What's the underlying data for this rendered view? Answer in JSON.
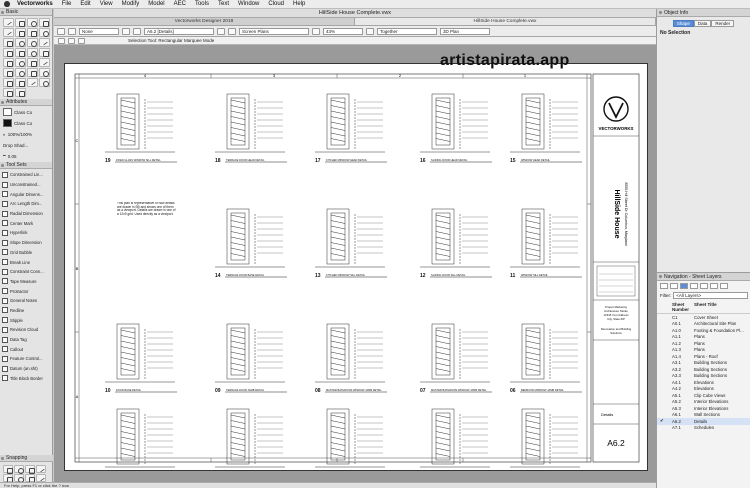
{
  "menubar": {
    "app": "Vectorworks",
    "items": [
      "File",
      "Edit",
      "View",
      "Modify",
      "Model",
      "AEC",
      "Tools",
      "Text",
      "Window",
      "Cloud",
      "Help"
    ]
  },
  "window": {
    "title": "HillSide House Complete.vwx",
    "tabs": [
      "Vectorworks Designer 2018",
      "HillSide House Complete.vwx"
    ]
  },
  "viewbar": {
    "view": "None",
    "sheet": "A6.2 [Details]",
    "class": "Screen Plans",
    "zoom": "43%",
    "render": "Together",
    "plane": "3D Plan"
  },
  "modebar": {
    "tool_hint": "Selection Tool: Rectangular Marquee Mode"
  },
  "left": {
    "basic_title": "Basic",
    "attributes_title": "Attributes",
    "class_label": "Class Co",
    "fill_label": "Class Co",
    "opacity": "100%/100%",
    "drop_shadow": "Drop Shad...",
    "stroke": "0.05",
    "toolsets_title": "Tool Sets",
    "toolsets": [
      "Constrained Lin...",
      "Unconstrained...",
      "Angular Dimens...",
      "Arc Length Dim...",
      "Radial Dimension",
      "Center Mark",
      "Hyperlink",
      "Slope Dimension",
      "Grid Bubble",
      "Break Line",
      "Constraint Conn...",
      "Tape Measure",
      "Protractor",
      "General Notes",
      "Redline",
      "Stipple",
      "Revision Cloud",
      "Data Tag",
      "Callout",
      "Feature Control...",
      "Datum (an.sht)",
      "Title Block Border"
    ],
    "snapping_title": "Snapping"
  },
  "status": {
    "hint": "For Help, press F1 or click the ? icon"
  },
  "watermark": "artistapirata.app",
  "sheet": {
    "grid_numbers": [
      "4",
      "3",
      "2",
      "1"
    ],
    "grid_letters": [
      "C",
      "B",
      "A"
    ],
    "logo_text": "VECTORWORKS",
    "project": "HillSide House",
    "address": "8555 Hill Street Dr\nColumbus, Maryland",
    "sheet_title": "Details",
    "sheet_number": "A6.2",
    "details": [
      {
        "num": "19",
        "label": "FIXED GLASS WINDOW SILL DETAIL"
      },
      {
        "num": "18",
        "label": "TERRACE DOOR HEAD DETAIL"
      },
      {
        "num": "17",
        "label": "KITCHEN WINDOW HEAD DETAIL"
      },
      {
        "num": "16",
        "label": "SLIDING DOOR HEAD DETAIL"
      },
      {
        "num": "15",
        "label": "WINDOW HEAD DETAIL"
      },
      {
        "num": "14",
        "label": "TERRACE DOOR BASE DETAIL"
      },
      {
        "num": "13",
        "label": "KITCHEN WINDOW SILL DETAIL"
      },
      {
        "num": "12",
        "label": "SLIDING DOOR SILL DETAIL"
      },
      {
        "num": "11",
        "label": "WINDOW SILL DETAIL"
      },
      {
        "num": "10",
        "label": "DOOR BASE DETAIL"
      },
      {
        "num": "09",
        "label": "TERRACE DOOR JAMB DETAIL"
      },
      {
        "num": "08",
        "label": "MASTER BATHROOM WINDOW JAMB DETAIL"
      },
      {
        "num": "07",
        "label": "MASTER BATHROOM WINDOW JAMB DETAIL"
      },
      {
        "num": "06",
        "label": "BEDROOM WINDOW JAMB DETAIL"
      },
      {
        "num": "05",
        "label": "WINDOW JAMB DETAIL"
      },
      {
        "num": "04",
        "label": "WINDOW JAMB DETAIL"
      },
      {
        "num": "03",
        "label": "WINDOW JAMB DETAIL"
      },
      {
        "num": "02",
        "label": "SLIDING DOOR JAMB DETAIL"
      },
      {
        "num": "01",
        "label": "WINDOW JAMB DETAIL"
      }
    ],
    "note": "This plan is representative of how details are drawn in SB and shows one of them as a viewport. Details are drawn in one of a 12x9 grid. Used directly as a viewport."
  },
  "right": {
    "object_info_title": "Object Info",
    "oi_tabs": [
      "Shape",
      "Data",
      "Render"
    ],
    "no_selection": "No Selection",
    "navigation_title": "Navigation - Sheet Layers",
    "filter_label": "Filter:",
    "filter_value": "<All Layers>",
    "col_number": "Sheet Number",
    "col_title": "Sheet Title",
    "sheets": [
      {
        "num": "C1",
        "title": "Cover Sheet"
      },
      {
        "num": "A0.1",
        "title": "Architectural Site Plan"
      },
      {
        "num": "A1.0",
        "title": "Footing & Foundation Pl..."
      },
      {
        "num": "A1.1",
        "title": "Plans"
      },
      {
        "num": "A1.2",
        "title": "Plans"
      },
      {
        "num": "A1.3",
        "title": "Plans"
      },
      {
        "num": "A1.4",
        "title": "Plans - Roof"
      },
      {
        "num": "A3.1",
        "title": "Building Sections"
      },
      {
        "num": "A3.2",
        "title": "Building Sections"
      },
      {
        "num": "A3.3",
        "title": "Building Sections"
      },
      {
        "num": "A4.1",
        "title": "Elevations"
      },
      {
        "num": "A4.2",
        "title": "Elevations"
      },
      {
        "num": "A5.1",
        "title": "Clip Cube Views"
      },
      {
        "num": "A5.2",
        "title": "Interior Elevations"
      },
      {
        "num": "A5.3",
        "title": "Interior Elevations"
      },
      {
        "num": "A6.1",
        "title": "Wall Sections"
      },
      {
        "num": "A6.2",
        "title": "Details"
      },
      {
        "num": "A7.1",
        "title": "Schedules"
      }
    ]
  }
}
